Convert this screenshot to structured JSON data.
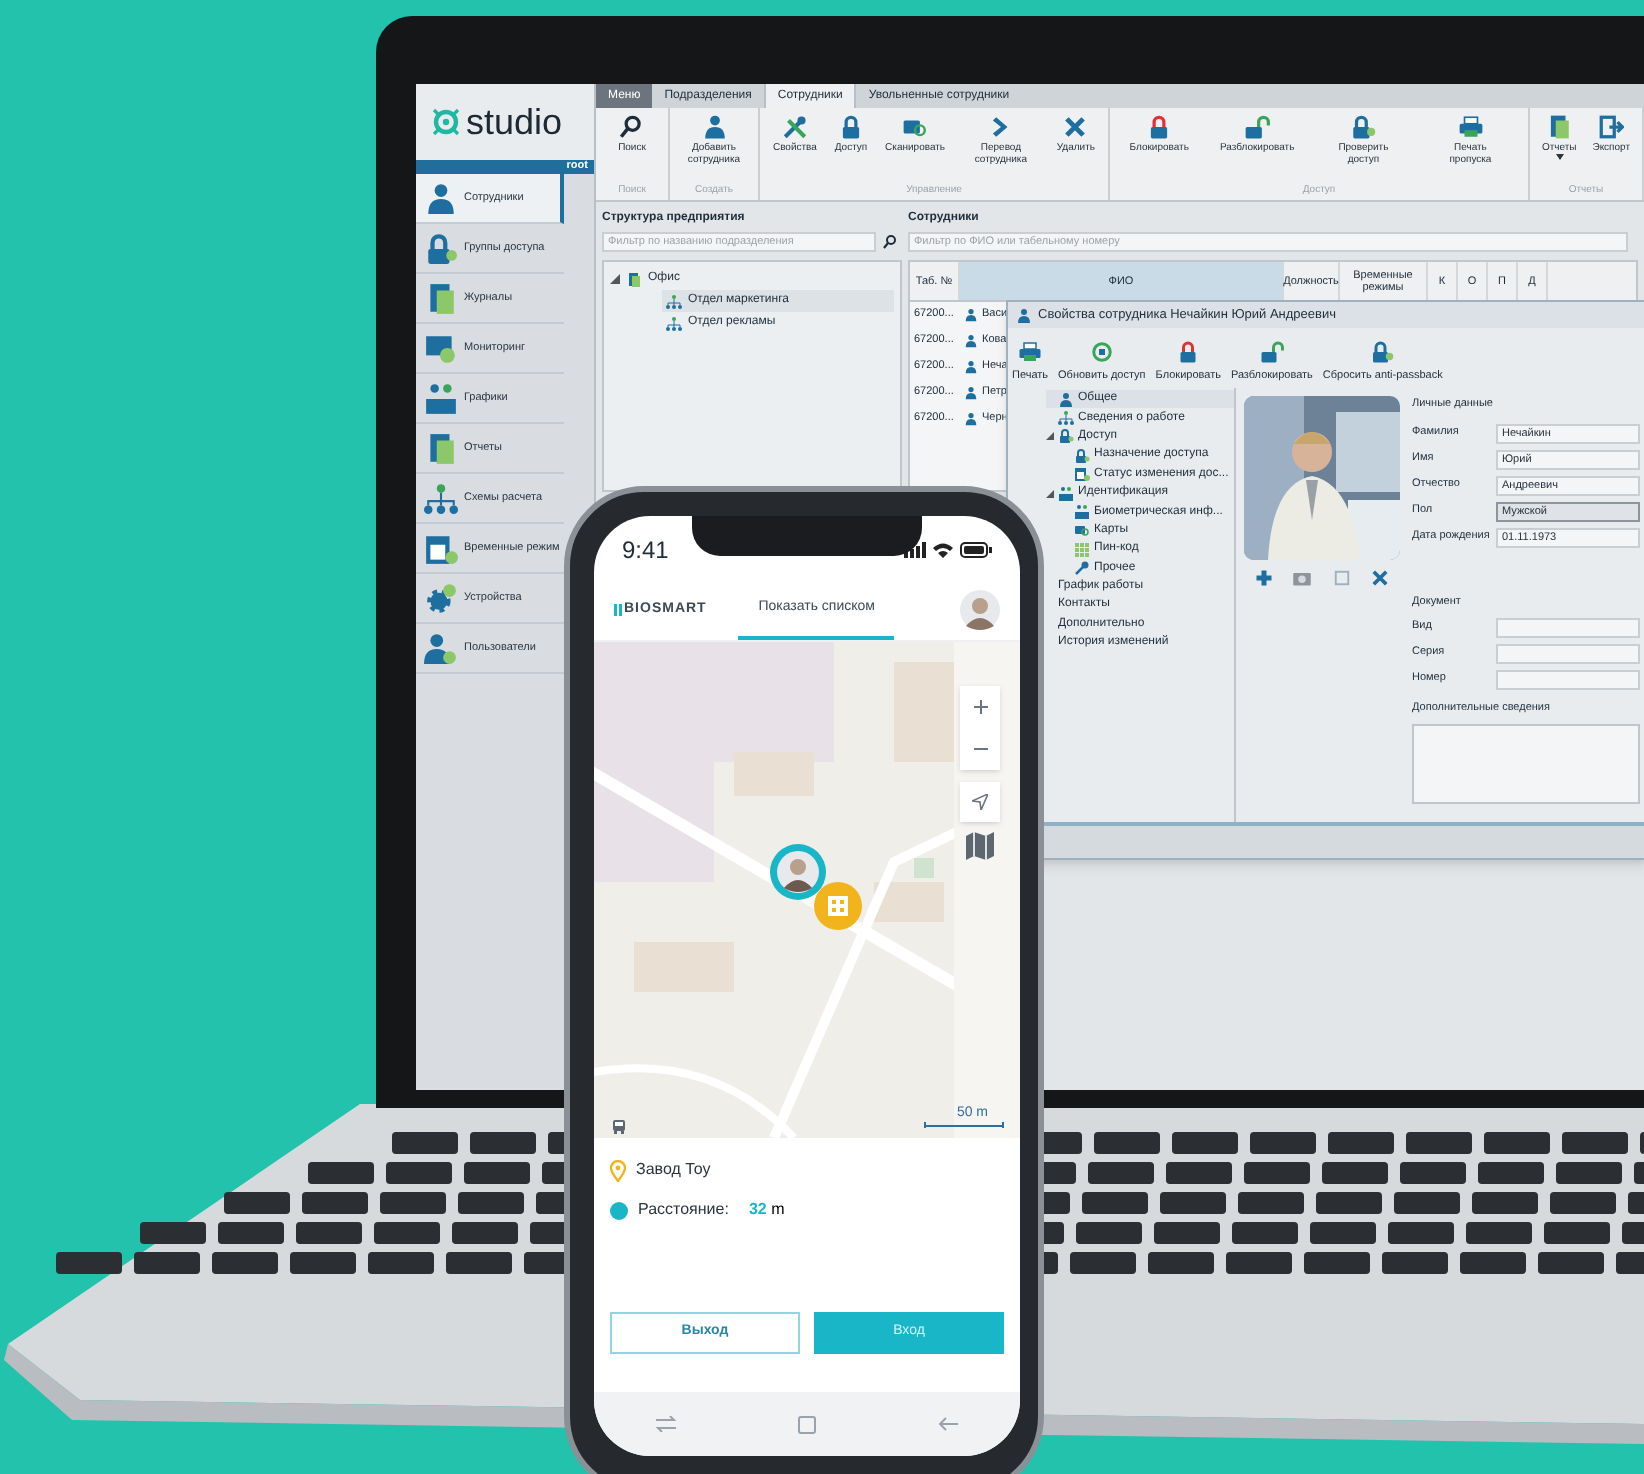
{
  "laptop": {
    "logo": "studio",
    "user": "root",
    "sidebar": [
      {
        "label": "Сотрудники",
        "selected": true
      },
      {
        "label": "Группы доступа",
        "selected": false
      },
      {
        "label": "Журналы",
        "selected": false
      },
      {
        "label": "Мониторинг",
        "selected": false
      },
      {
        "label": "Графики",
        "selected": false
      },
      {
        "label": "Отчеты",
        "selected": false
      },
      {
        "label": "Схемы расчета",
        "selected": false
      },
      {
        "label": "Временные режим",
        "selected": false
      },
      {
        "label": "Устройства",
        "selected": false
      },
      {
        "label": "Пользователи",
        "selected": false
      }
    ],
    "tabs": [
      {
        "label": "Меню",
        "kind": "menu",
        "selected": false
      },
      {
        "label": "Подразделения",
        "kind": "tab",
        "selected": false
      },
      {
        "label": "Сотрудники",
        "kind": "tab",
        "selected": true
      },
      {
        "label": "Увольненные сотрудники",
        "kind": "tab",
        "selected": false
      }
    ],
    "ribbon": [
      {
        "label": "Поиск",
        "buttons": [
          {
            "label": "Поиск",
            "dropdown": false
          }
        ]
      },
      {
        "label": "Создать",
        "buttons": [
          {
            "label": "Добавить сотрудника",
            "dropdown": false
          }
        ]
      },
      {
        "label": "Управление",
        "buttons": [
          {
            "label": "Свойства",
            "dropdown": false
          },
          {
            "label": "Доступ",
            "dropdown": false
          },
          {
            "label": "Сканировать",
            "dropdown": false
          },
          {
            "label": "Перевод сотрудника",
            "dropdown": false
          },
          {
            "label": "Удалить",
            "dropdown": false
          }
        ]
      },
      {
        "label": "Доступ",
        "buttons": [
          {
            "label": "Блокировать",
            "dropdown": false
          },
          {
            "label": "Разблокировать",
            "dropdown": false
          },
          {
            "label": "Проверить доступ",
            "dropdown": false
          },
          {
            "label": "Печать пропуска",
            "dropdown": false
          }
        ]
      },
      {
        "label": "Отчеты",
        "buttons": [
          {
            "label": "Отчеты",
            "dropdown": true
          },
          {
            "label": "Экспорт",
            "dropdown": false
          }
        ]
      }
    ],
    "structure": {
      "title": "Структура предприятия",
      "filter_placeholder": "Фильтр по названию подразделения",
      "tree": [
        {
          "label": "Офис",
          "expanded": true,
          "selected": false,
          "children": [
            {
              "label": "Отдел маркетинга",
              "selected": true
            },
            {
              "label": "Отдел рекламы",
              "selected": false
            }
          ]
        }
      ]
    },
    "employees": {
      "title": "Сотрудники",
      "filter_placeholder": "Фильтр по ФИО или табельному номеру",
      "columns": [
        {
          "label": "Таб. №",
          "selected": false
        },
        {
          "label": "ФИО",
          "selected": true
        },
        {
          "label": "Должность",
          "selected": false
        },
        {
          "label": "Временные режимы",
          "selected": false
        },
        {
          "label": "К",
          "selected": false
        },
        {
          "label": "О",
          "selected": false
        },
        {
          "label": "П",
          "selected": false
        },
        {
          "label": "Д",
          "selected": false
        }
      ],
      "rows": [
        {
          "number": "67200...",
          "name": "Васи"
        },
        {
          "number": "67200...",
          "name": "Кова"
        },
        {
          "number": "67200...",
          "name": "Неча"
        },
        {
          "number": "67200...",
          "name": "Петр"
        },
        {
          "number": "67200...",
          "name": "Черн"
        }
      ]
    },
    "dialog": {
      "title": "Свойства сотрудника Нечайкин Юрий Андреевич",
      "toolbar": [
        "Печать",
        "Обновить доступ",
        "Блокировать",
        "Разблокировать",
        "Сбросить anti-passback"
      ],
      "nav": [
        {
          "label": "Общее",
          "selected": true
        },
        {
          "label": "Сведения о работе",
          "selected": false
        },
        {
          "label": "Доступ",
          "selected": false,
          "expanded": true,
          "children": [
            {
              "label": "Назначение доступа",
              "selected": false
            },
            {
              "label": "Статус изменения дос...",
              "selected": false
            }
          ]
        },
        {
          "label": "Идентификация",
          "selected": false,
          "expanded": true,
          "children": [
            {
              "label": "Биометрическая инф...",
              "selected": false
            },
            {
              "label": "Карты",
              "selected": false
            },
            {
              "label": "Пин-код",
              "selected": false
            },
            {
              "label": "Прочее",
              "selected": false
            }
          ]
        },
        {
          "label": "График работы",
          "selected": false
        },
        {
          "label": "Контакты",
          "selected": false
        },
        {
          "label": "Дополнительно",
          "selected": false
        },
        {
          "label": "История изменений",
          "selected": false
        }
      ],
      "personal": {
        "title": "Личные данные",
        "fields": [
          {
            "label": "Фамилия",
            "value": "Нечайкин",
            "kind": "text"
          },
          {
            "label": "Имя",
            "value": "Юрий",
            "kind": "text"
          },
          {
            "label": "Отчество",
            "value": "Андреевич",
            "kind": "text"
          },
          {
            "label": "Пол",
            "value": "Мужской",
            "kind": "select"
          },
          {
            "label": "Дата рождения",
            "value": "01.11.1973",
            "kind": "text"
          }
        ]
      },
      "document": {
        "title": "Документ",
        "fields": [
          {
            "label": "Вид"
          },
          {
            "label": "Серия"
          },
          {
            "label": "Номер"
          }
        ]
      },
      "additional": {
        "title": "Дополнительные сведения"
      }
    }
  },
  "phone": {
    "time": "9:41",
    "brand": "BIOSMART",
    "tab": {
      "label": "Показать списком",
      "selected": true
    },
    "map_scale": "50 m",
    "place": "Завод Тоу",
    "distance_label": "Расстояние:",
    "distance_value": "32",
    "distance_unit": "m",
    "buttons": [
      {
        "label": "Выход",
        "kind": "outline"
      },
      {
        "label": "Вход",
        "kind": "filled"
      }
    ]
  }
}
